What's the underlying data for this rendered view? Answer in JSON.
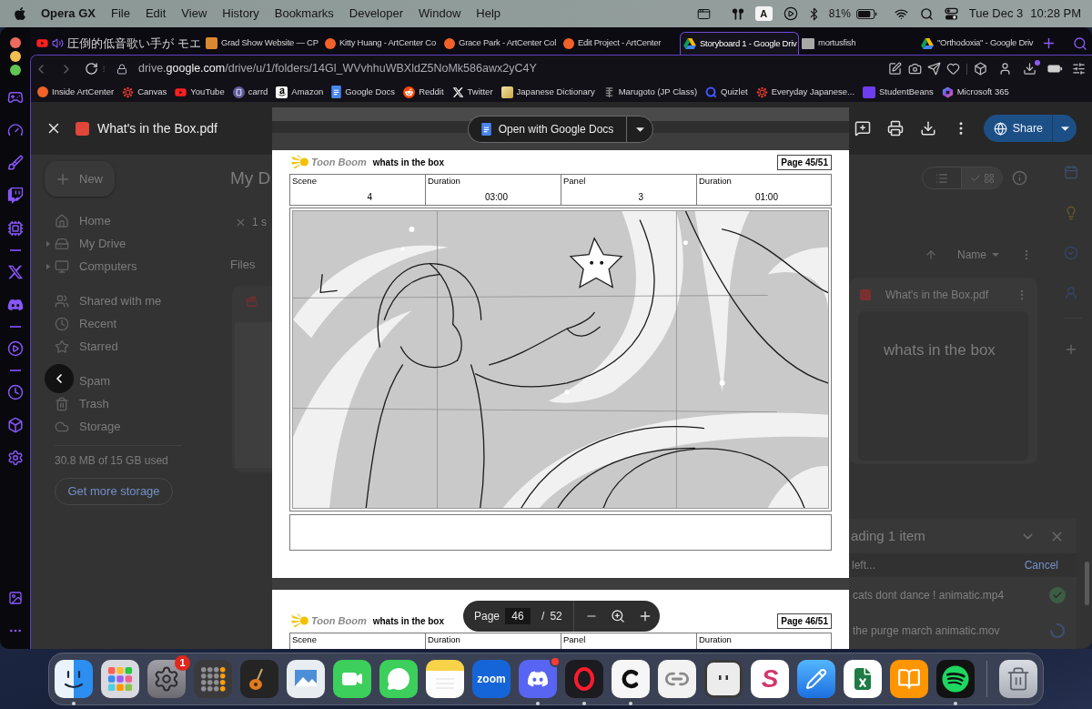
{
  "menu_bar": {
    "app_name": "Opera GX",
    "menus": [
      "File",
      "Edit",
      "View",
      "History",
      "Bookmarks",
      "Developer",
      "Window",
      "Help"
    ],
    "input_source": "A",
    "battery": "81%",
    "date": "Tue Dec 3",
    "time": "10:28 PM"
  },
  "tabs": [
    {
      "title": "圧倒的低音歌い手が モエ",
      "audio": true,
      "selected": false
    },
    {
      "title": "Grad Show Website — CP",
      "audio": false,
      "selected": false
    },
    {
      "title": "Kitty Huang - ArtCenter Co",
      "audio": false,
      "selected": false
    },
    {
      "title": "Grace Park - ArtCenter Col",
      "audio": false,
      "selected": false
    },
    {
      "title": "Edit Project - ArtCenter",
      "audio": false,
      "selected": false
    },
    {
      "title": "Storyboard 1 - Google Driv",
      "audio": false,
      "selected": true
    },
    {
      "title": "mortusfish",
      "audio": false,
      "selected": false
    },
    {
      "title": "\"Orthodoxia\" - Google Driv",
      "audio": false,
      "selected": false
    }
  ],
  "address_bar": {
    "subdomain": "drive.",
    "domain": "google.com",
    "path": "/drive/u/1/folders/14Gl_WVvhhuWBXldZ5NoMk586awx2yC4Y"
  },
  "bookmarks": [
    "Inside ArtCenter",
    "Canvas",
    "YouTube",
    "carrd",
    "Amazon",
    "Google Docs",
    "Reddit",
    "Twitter",
    "Japanese Dictionary",
    "Marugoto (JP Class)",
    "Quizlet",
    "Everyday Japanese...",
    "StudentBeans",
    "Microsoft 365"
  ],
  "viewer": {
    "file_name": "What's in the Box.pdf",
    "share_label": "Share",
    "open_with_label": "Open with Google Docs",
    "pages": [
      {
        "brand": "Toon Boom",
        "title": "whats in the box",
        "page_label": "Page 45/51",
        "fields": [
          {
            "label": "Scene",
            "value": "4"
          },
          {
            "label": "Duration",
            "value": "03:00"
          },
          {
            "label": "Panel",
            "value": "3"
          },
          {
            "label": "Duration",
            "value": "01:00"
          }
        ]
      },
      {
        "brand": "Toon Boom",
        "title": "whats in the box",
        "page_label": "Page 46/51",
        "fields": [
          {
            "label": "Scene"
          },
          {
            "label": "Duration"
          },
          {
            "label": "Panel"
          },
          {
            "label": "Duration"
          }
        ]
      }
    ],
    "page_toolbar": {
      "label": "Page",
      "current": "46",
      "separator": "/",
      "total": "52"
    }
  },
  "drive": {
    "new_label": "New",
    "nav_groups": [
      {
        "items": [
          {
            "label": "Home",
            "expandable": false
          },
          {
            "label": "My Drive",
            "expandable": true
          },
          {
            "label": "Computers",
            "expandable": true
          }
        ]
      },
      {
        "items": [
          {
            "label": "Shared with me",
            "expandable": false
          },
          {
            "label": "Recent",
            "expandable": false
          },
          {
            "label": "Starred",
            "expandable": false
          }
        ]
      },
      {
        "items": [
          {
            "label": "Spam",
            "expandable": false
          },
          {
            "label": "Trash",
            "expandable": false
          },
          {
            "label": "Storage",
            "expandable": false
          }
        ]
      }
    ],
    "storage_text": "30.8 MB of 15 GB used",
    "storage_button": "Get more storage",
    "heading": "My D",
    "selection": "1 s",
    "section_label": "Files",
    "view_toggle": [
      {
        "selected": false
      },
      {
        "selected": true
      }
    ],
    "sort_label": "Name",
    "file_card": {
      "name": "What's in the Box.pdf",
      "preview_text": "whats in the box"
    }
  },
  "upload_panel": {
    "title": "ading 1 item",
    "status": "left...",
    "action": "Cancel",
    "items": [
      {
        "name": "cats dont dance ! animatic.mp4",
        "completed": true
      },
      {
        "name": "the purge march animatic.mov",
        "completed": false
      }
    ]
  },
  "dock": [
    {
      "running": true,
      "alert": false
    },
    {
      "running": false,
      "alert": false
    },
    {
      "running": false,
      "alert": false,
      "badge": "1"
    },
    {
      "running": false,
      "alert": false
    },
    {
      "running": false,
      "alert": false
    },
    {
      "running": false,
      "alert": false
    },
    {
      "running": false,
      "alert": false
    },
    {
      "running": false,
      "alert": false
    },
    {
      "running": false,
      "alert": false
    },
    {
      "running": false,
      "alert": false,
      "label": "zoom"
    },
    {
      "running": true,
      "alert": true
    },
    {
      "running": true,
      "alert": false
    },
    {
      "running": true,
      "alert": false
    },
    {
      "running": false,
      "alert": false
    },
    {
      "running": false,
      "alert": false
    },
    {
      "running": false,
      "alert": false,
      "label": "S"
    },
    {
      "running": false,
      "alert": false
    },
    {
      "running": false,
      "alert": false
    },
    {
      "running": false,
      "alert": false
    },
    {
      "running": true,
      "alert": false
    },
    {
      "running": false,
      "alert": false
    }
  ]
}
